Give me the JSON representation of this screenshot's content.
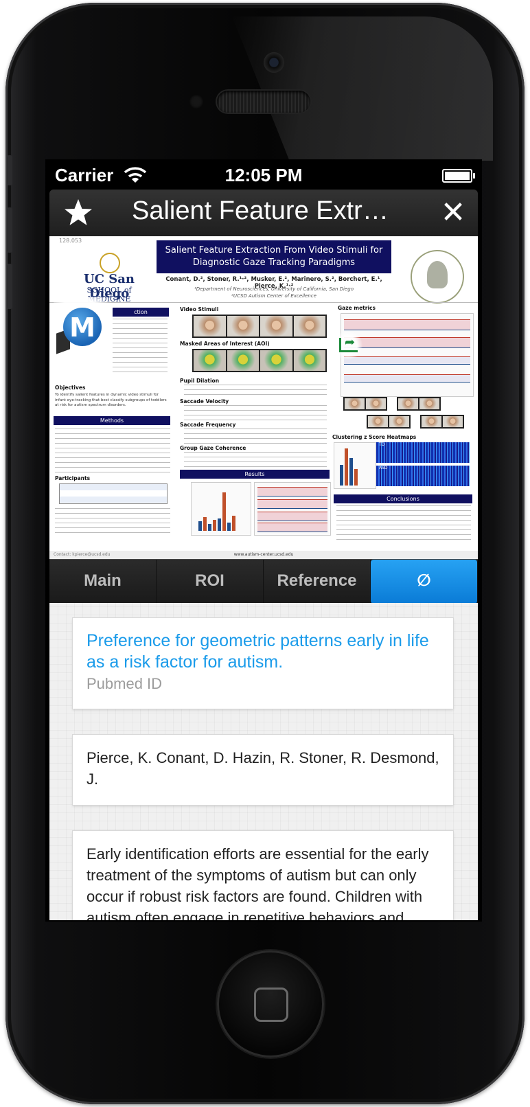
{
  "status_bar": {
    "carrier": "Carrier",
    "time": "12:05 PM"
  },
  "nav_bar": {
    "title": "Salient Feature Extra…",
    "favorite_icon": "star-icon",
    "close_icon": "close-icon",
    "close_label": "✕"
  },
  "poster": {
    "poster_id": "128.053",
    "title_line1": "Salient Feature Extraction From Video Stimuli for",
    "title_line2": "Diagnostic Gaze Tracking Paradigms",
    "authors": "Conant, D.², Stoner, R.¹·², Musker, E.², Marinero, S.², Borchert, E.¹, Pierce, K.¹·²",
    "affiliation1": "¹Department of Neurosciences, University of California, San Diego",
    "affiliation2": "²UCSD Autism Center of Excellence",
    "institution": "UC San Diego",
    "school": "SCHOOL of MEDICINE",
    "sections": {
      "introduction": "ction",
      "objectives": "Objectives",
      "methods": "Methods",
      "participants": "Participants",
      "video_stimuli": "Video Stimuli",
      "masked_aoi": "Masked Areas of Interest (AOI)",
      "pupil_dilation": "Pupil Dilation",
      "saccade_velocity": "Saccade Velocity",
      "saccade_frequency": "Saccade Frequency",
      "group_gaze": "Group Gaze Coherence",
      "results": "Results",
      "gaze_metrics": "Gaze metrics",
      "heatmaps": "Clustering z Score Heatmaps",
      "conclusions": "Conclusions"
    },
    "heatmap_labels": {
      "td": "TD",
      "asd": "ASD"
    },
    "objectives_text": "To identify salient features in dynamic video stimuli for infant eye-tracking that best classify subgroups of toddlers at risk for autism spectrum disorders.",
    "footer_url": "www.autism-center.ucsd.edu",
    "footer_contact": "Contact: kpierce@ucsd.edu"
  },
  "overlays": {
    "app_logo_icon": "m-logo-icon",
    "app_logo_letter": "M",
    "share_icon": "share-icon"
  },
  "tabs": [
    {
      "label": "Main",
      "active": false
    },
    {
      "label": "ROI",
      "active": false
    },
    {
      "label": "Reference",
      "active": false
    },
    {
      "label": "∅",
      "active": true
    }
  ],
  "reference": {
    "title": "Preference for geometric patterns early in life as a risk factor for autism.",
    "id_label": "Pubmed ID",
    "authors": "Pierce, K. Conant, D. Hazin, R. Stoner, R. Desmond, J.",
    "abstract": "Early identification efforts are essential for the early treatment of the symptoms of autism but can only occur if robust risk factors are found. Children with autism often engage in repetitive behaviors and"
  },
  "colors": {
    "accent": "#1a9bea",
    "active_tab": "#0a7bd6",
    "poster_banner": "#101060"
  }
}
